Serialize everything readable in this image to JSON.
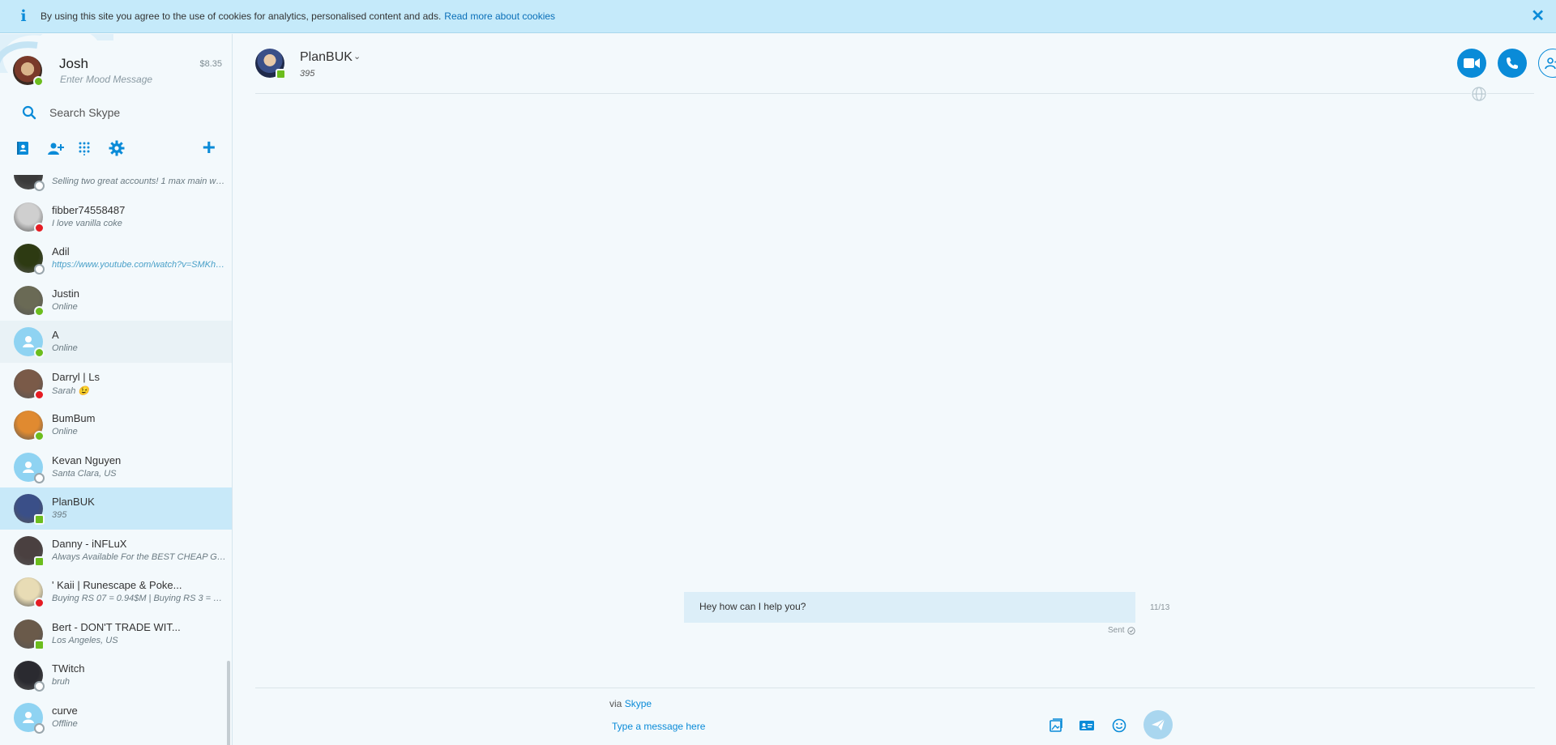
{
  "cookie_banner": {
    "text": "By using this site you agree to the use of cookies for analytics, personalised content and ads.",
    "link": "Read more about cookies",
    "close": "✕"
  },
  "profile": {
    "name": "Josh",
    "mood_placeholder": "Enter Mood Message",
    "credit": "$8.35",
    "status": "online"
  },
  "search": {
    "placeholder": "Search Skype"
  },
  "toolbar": {
    "icons": [
      "contacts-icon",
      "add-contact-icon",
      "dialpad-icon",
      "settings-icon"
    ],
    "add": "+"
  },
  "contacts": [
    {
      "name": "",
      "mood": "Selling two great accounts! 1 max main wit...",
      "status": "offline",
      "avatar": "#3a3a3a"
    },
    {
      "name": "fibber74558487",
      "mood": "I love vanilla coke",
      "status": "busy",
      "avatar": "#cfcfcf"
    },
    {
      "name": "Adil",
      "mood": "https://www.youtube.com/watch?v=SMKhli...",
      "status": "offline",
      "avatar": "#2d3a12",
      "link": true
    },
    {
      "name": "Justin",
      "mood": "Online",
      "status": "online",
      "avatar": "#6a6a55"
    },
    {
      "name": "A",
      "mood": "Online",
      "status": "online",
      "avatar": "default"
    },
    {
      "name": "Darryl | Ls",
      "mood": "Sarah 😉",
      "status": "busy",
      "avatar": "#7a5a48"
    },
    {
      "name": "BumBum",
      "mood": "Online",
      "status": "online",
      "avatar": "#e08a30"
    },
    {
      "name": "Kevan Nguyen",
      "mood": "Santa Clara, US",
      "status": "offline",
      "avatar": "default"
    },
    {
      "name": "PlanBUK",
      "mood": "395",
      "status": "mobile",
      "avatar": "#3a4f88"
    },
    {
      "name": "Danny - iNFLuX",
      "mood": "Always Available For the BEST CHEAP GRA...",
      "status": "mobile",
      "avatar": "#4a4040"
    },
    {
      "name": "' Kaii | Runescape & Poke...",
      "mood": "Buying RS 07 = 0.94$M | Buying RS 3 = 0.1...",
      "status": "busy",
      "avatar": "#e8dcb5"
    },
    {
      "name": "Bert - DON'T TRADE WIT...",
      "mood": "Los Angeles, US",
      "status": "mobile",
      "avatar": "#6a5a4a"
    },
    {
      "name": "TWitch",
      "mood": "bruh",
      "status": "offline",
      "avatar": "#2a2a30"
    },
    {
      "name": "curve",
      "mood": "Offline",
      "status": "offline",
      "avatar": "default"
    }
  ],
  "chat": {
    "name": "PlanBUK",
    "mood": "395",
    "header_buttons": [
      "video-call-icon",
      "call-icon",
      "add-people-icon"
    ],
    "messages": [
      {
        "text": "Hey how can I help you?",
        "time": "11/13",
        "status": "Sent"
      }
    ],
    "via_prefix": "via",
    "via_brand": "Skype",
    "composer_placeholder": "Type a message here",
    "composer_icons": [
      "send-file-icon",
      "send-contact-icon",
      "emoticon-icon",
      "send-icon"
    ]
  },
  "colors": {
    "accent": "#0a8bd8",
    "banner": "#c5eafa",
    "selected": "#c8e9f9",
    "bubble": "#dceef8"
  }
}
